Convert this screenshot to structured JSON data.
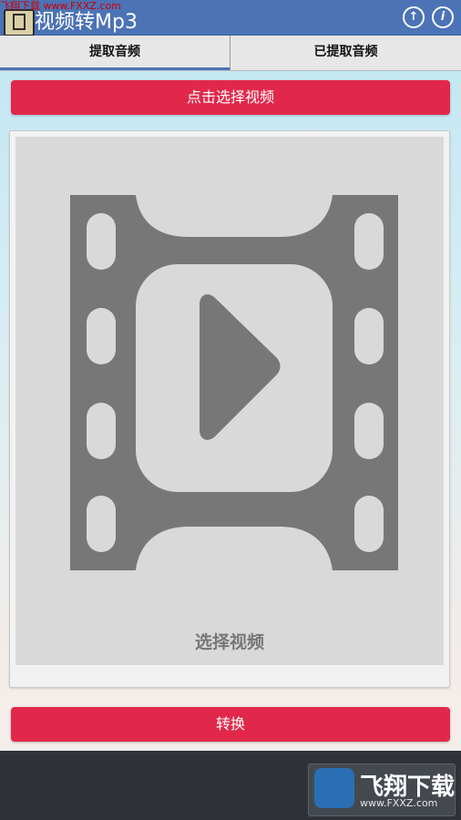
{
  "watermark": {
    "top_text": "飞翔下载 www.FXXZ.com"
  },
  "titlebar": {
    "title": "视频转Mp3",
    "upload_icon_label": "↑",
    "info_icon_label": "i"
  },
  "tabs": [
    {
      "label": "提取音频",
      "active": true
    },
    {
      "label": "已提取音频",
      "active": false
    }
  ],
  "actions": {
    "select_video_label": "点击选择视频",
    "convert_label": "转换"
  },
  "card": {
    "caption": "选择视频",
    "icon": "film-play-icon"
  },
  "footer_logo": {
    "name": "飞翔下载",
    "url": "www.FXXZ.com"
  },
  "colors": {
    "titlebar": "#4b73b6",
    "primary_button": "#e2284a",
    "icon_gray": "#777777"
  }
}
